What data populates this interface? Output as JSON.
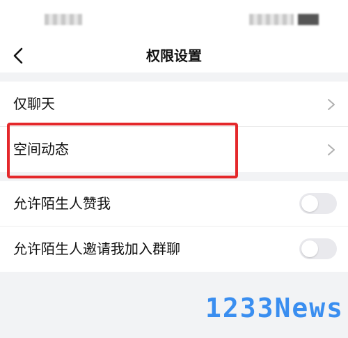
{
  "nav": {
    "title": "权限设置"
  },
  "settings": {
    "group1": [
      {
        "label": "仅聊天"
      },
      {
        "label": "空间动态"
      }
    ],
    "group2": [
      {
        "label": "允许陌生人赞我",
        "enabled": false
      },
      {
        "label": "允许陌生人邀请我加入群聊",
        "enabled": false
      }
    ]
  },
  "colors": {
    "highlight": "#e4282b",
    "watermark": "#3a8ef0",
    "toggle_off": "#e9e9ed"
  },
  "watermark": "1233News"
}
